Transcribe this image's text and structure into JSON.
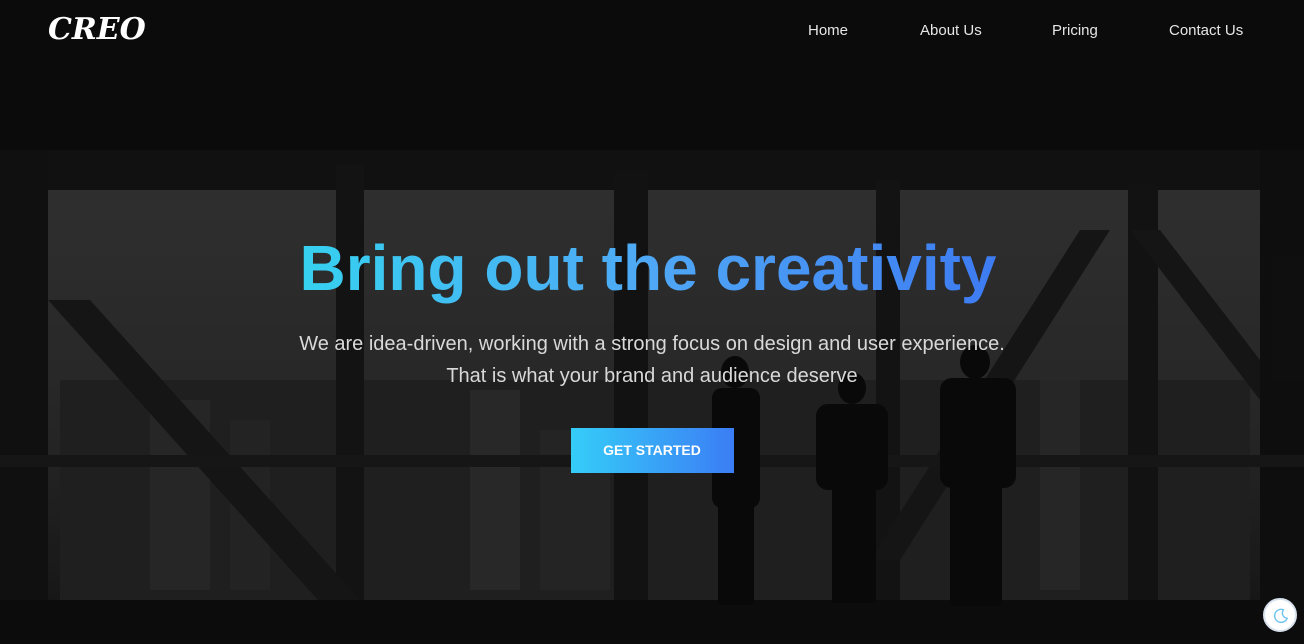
{
  "brand": {
    "logo_text": "CREO"
  },
  "nav": {
    "items": [
      {
        "label": "Home"
      },
      {
        "label": "About Us"
      },
      {
        "label": "Pricing"
      },
      {
        "label": "Contact Us"
      }
    ]
  },
  "hero": {
    "headline": "Bring out the creativity",
    "subtitle_line1": "We are idea-driven, working with a strong focus on design and user experience.",
    "subtitle_line2": "That is what your brand and audience deserve",
    "cta_label": "GET STARTED"
  },
  "theme_toggle": {
    "icon": "moon-icon"
  },
  "colors": {
    "accent_start": "#36d1f0",
    "accent_end": "#3d7bf2",
    "nav_text": "#e6e6e6",
    "body_text": "#d9d9d9"
  }
}
